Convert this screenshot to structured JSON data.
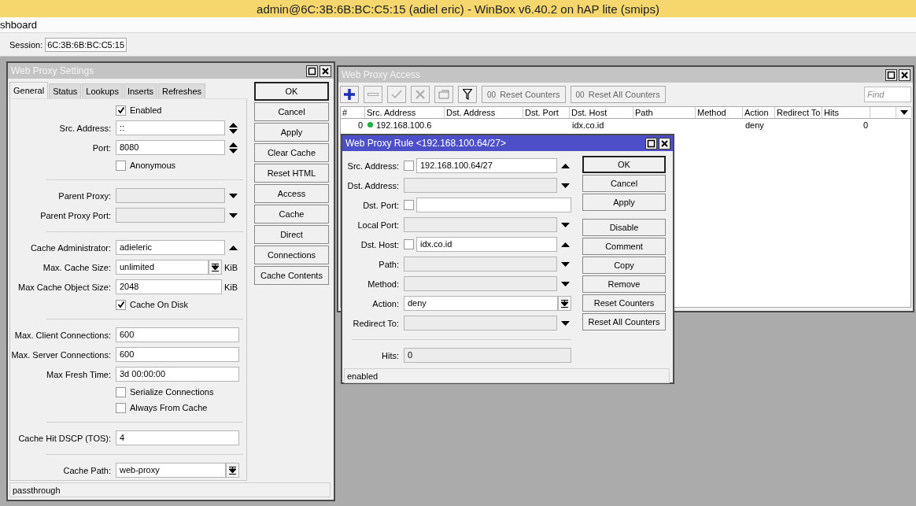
{
  "window": {
    "title": "admin@6C:3B:6B:BC:C5:15 (adiel eric) - WinBox v6.40.2 on hAP lite (smips)"
  },
  "menu": {
    "label": "shboard"
  },
  "session": {
    "label": "Session:",
    "value": "6C:3B:6B:BC:C5:15"
  },
  "settings_window": {
    "title": "Web Proxy Settings",
    "active": false,
    "tabs": [
      {
        "label": "General",
        "selected": true
      },
      {
        "label": "Status",
        "selected": false
      },
      {
        "label": "Lookups",
        "selected": false
      },
      {
        "label": "Inserts",
        "selected": false
      },
      {
        "label": "Refreshes",
        "selected": false
      }
    ],
    "rows": [
      {
        "kind": "checkbox",
        "label": "Enabled",
        "checked": true
      },
      {
        "kind": "field",
        "label": "Src. Address:",
        "value": "::",
        "disabled": false,
        "addon": {
          "kind": "updown"
        }
      },
      {
        "kind": "field",
        "label": "Port:",
        "value": "8080",
        "disabled": false,
        "addon": {
          "kind": "updown"
        }
      },
      {
        "kind": "checkbox",
        "label": "Anonymous",
        "checked": false
      },
      {
        "kind": "separator"
      },
      {
        "kind": "field",
        "label": "Parent Proxy:",
        "disabled": true,
        "addon": {
          "kind": "down"
        }
      },
      {
        "kind": "field",
        "label": "Parent Proxy Port:",
        "disabled": true,
        "addon": {
          "kind": "down"
        }
      },
      {
        "kind": "separator"
      },
      {
        "kind": "field",
        "label": "Cache Administrator:",
        "value": "adieleric",
        "disabled": false,
        "addon": {
          "kind": "up"
        }
      },
      {
        "kind": "field",
        "label": "Max. Cache Size:",
        "value": "unlimited",
        "disabled": false,
        "addon": {
          "kind": "dropdown"
        },
        "unit": "KiB"
      },
      {
        "kind": "field",
        "label": "Max Cache Object Size:",
        "value": "2048",
        "disabled": false,
        "unit": "KiB"
      },
      {
        "kind": "checkbox",
        "label": "Cache On Disk",
        "checked": true
      },
      {
        "kind": "separator"
      },
      {
        "kind": "field",
        "label": "Max. Client Connections:",
        "value": "600",
        "disabled": false
      },
      {
        "kind": "field",
        "label": "Max. Server Connections:",
        "value": "600",
        "disabled": false
      },
      {
        "kind": "field",
        "label": "Max Fresh Time:",
        "value": "3d 00:00:00",
        "disabled": false
      },
      {
        "kind": "checkbox",
        "label": "Serialize Connections",
        "checked": false
      },
      {
        "kind": "checkbox",
        "label": "Always From Cache",
        "checked": false
      },
      {
        "kind": "separator"
      },
      {
        "kind": "field",
        "label": "Cache Hit DSCP (TOS):",
        "value": "4",
        "disabled": false
      },
      {
        "kind": "separator"
      },
      {
        "kind": "field",
        "label": "Cache Path:",
        "value": "web-proxy",
        "disabled": false,
        "addon": {
          "kind": "dropdown"
        }
      }
    ],
    "buttons": [
      {
        "label": "OK",
        "default": true
      },
      {
        "label": "Cancel",
        "default": false
      },
      {
        "label": "Apply",
        "default": false
      },
      {
        "label": "Clear Cache",
        "default": false
      },
      {
        "label": "Reset HTML",
        "default": false
      },
      {
        "label": "Access",
        "default": false
      },
      {
        "label": "Cache",
        "default": false
      },
      {
        "label": "Direct",
        "default": false
      },
      {
        "label": "Connections",
        "default": false
      },
      {
        "label": "Cache Contents",
        "default": false
      }
    ],
    "status": "passthrough"
  },
  "access_window": {
    "title": "Web Proxy Access",
    "active": false,
    "toolbar": [
      {
        "kind": "add",
        "disabled": false
      },
      {
        "kind": "remove",
        "disabled": true
      },
      {
        "kind": "enable",
        "disabled": true
      },
      {
        "kind": "disable",
        "disabled": true
      },
      {
        "kind": "comment",
        "disabled": true
      },
      {
        "kind": "filter",
        "disabled": false
      }
    ],
    "counter_buttons": [
      {
        "glyph": "00",
        "label": "Reset Counters",
        "disabled": true
      },
      {
        "glyph": "00",
        "label": "Reset All Counters",
        "disabled": true
      }
    ],
    "find": {
      "placeholder": "Find"
    },
    "columns": [
      "#",
      "Src. Address",
      "Dst. Address",
      "Dst. Port",
      "Dst. Host",
      "Path",
      "Method",
      "Action",
      "Redirect To",
      "Hits"
    ],
    "rows": [
      {
        "number": "0",
        "enabled": true,
        "src_address": "192.168.100.6",
        "dst_host": "idx.co.id",
        "action": "deny",
        "hits": "0"
      }
    ]
  },
  "rule_window": {
    "title": "Web Proxy Rule <192.168.100.64/27>",
    "active": true,
    "rows": [
      {
        "kind": "field",
        "label": "Src. Address:",
        "not_box": {
          "checked": false
        },
        "value": "192.168.100.64/27",
        "disabled": false,
        "addon": {
          "kind": "up"
        }
      },
      {
        "kind": "field",
        "label": "Dst. Address:",
        "disabled": true,
        "addon": {
          "kind": "down"
        }
      },
      {
        "kind": "field",
        "label": "Dst. Port:",
        "not_box": {
          "checked": false
        },
        "disabled": false
      },
      {
        "kind": "field",
        "label": "Local Port:",
        "disabled": true,
        "addon": {
          "kind": "down"
        }
      },
      {
        "kind": "field",
        "label": "Dst. Host:",
        "not_box": {
          "checked": false
        },
        "value": "idx.co.id",
        "disabled": false,
        "addon": {
          "kind": "up"
        }
      },
      {
        "kind": "field",
        "label": "Path:",
        "disabled": true,
        "addon": {
          "kind": "down"
        }
      },
      {
        "kind": "field",
        "label": "Method:",
        "disabled": true,
        "addon": {
          "kind": "down"
        }
      },
      {
        "kind": "field",
        "label": "Action:",
        "value": "deny",
        "disabled": false,
        "addon": {
          "kind": "dropdown"
        }
      },
      {
        "kind": "field",
        "label": "Redirect To:",
        "disabled": true,
        "addon": {
          "kind": "down"
        }
      },
      {
        "kind": "separator"
      },
      {
        "kind": "field",
        "label": "Hits:",
        "value": "0",
        "disabled": true
      }
    ],
    "button_groups": [
      {
        "buttons": [
          {
            "label": "OK",
            "default": true
          },
          {
            "label": "Cancel",
            "default": false
          },
          {
            "label": "Apply",
            "default": false
          }
        ]
      },
      {
        "buttons": [
          {
            "label": "Disable",
            "default": false
          },
          {
            "label": "Comment",
            "default": false
          },
          {
            "label": "Copy",
            "default": false
          },
          {
            "label": "Remove",
            "default": false
          },
          {
            "label": "Reset Counters",
            "default": false
          },
          {
            "label": "Reset All Counters",
            "default": false
          }
        ]
      }
    ],
    "status": "enabled"
  }
}
